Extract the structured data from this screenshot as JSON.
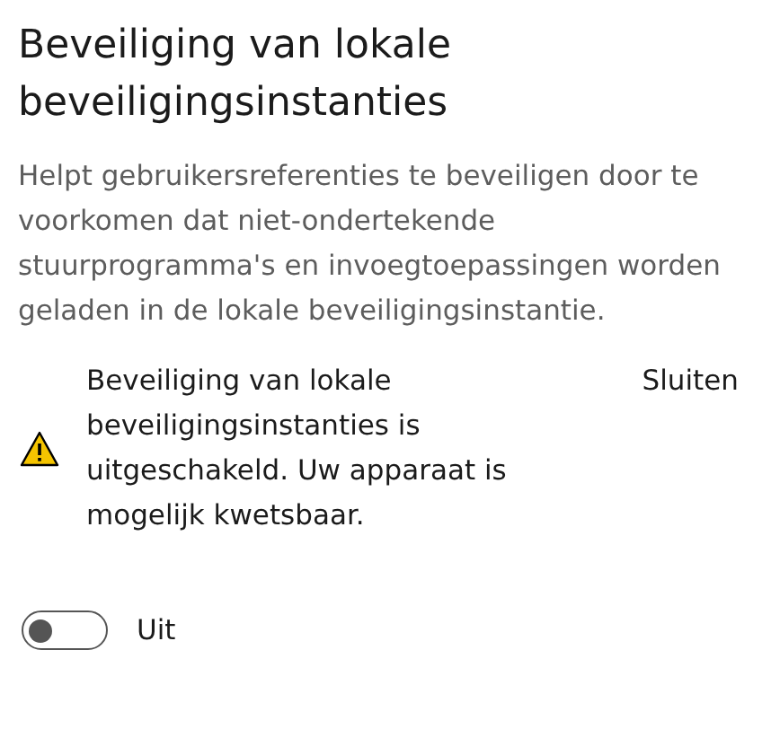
{
  "title": "Beveiliging van lokale beveiligingsinstanties",
  "description": "Helpt gebruikersreferenties te beveiligen door te voorkomen dat niet-ondertekende stuurprogramma's en invoegtoepassingen worden geladen in de lokale beveiligingsinstantie.",
  "alert": {
    "kind": "warning",
    "text": "Beveiliging van lokale beveiligingsinstanties is uitgeschakeld. Uw apparaat is mogelijk kwetsbaar.",
    "dismiss": "Sluiten"
  },
  "toggle": {
    "on": false,
    "label": "Uit"
  }
}
